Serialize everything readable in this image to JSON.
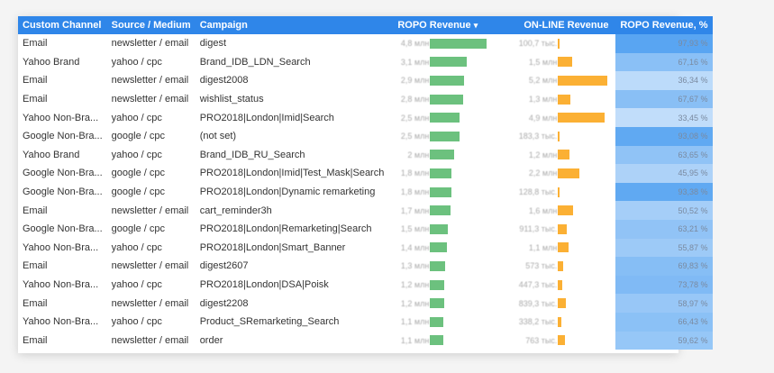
{
  "headers": {
    "channel": "Custom Channel",
    "source": "Source / Medium",
    "campaign": "Campaign",
    "ropo": "ROPO Revenue",
    "ropo_sort": "▾",
    "online": "ON-LINE Revenue",
    "pct": "ROPO Revenue, %"
  },
  "colors": {
    "header": "#2f86e9",
    "green": "#6cc17e",
    "orange": "#fbb034"
  },
  "rows": [
    {
      "channel": "Email",
      "source": "newsletter / email",
      "campaign": "digest",
      "ropo": "4,8 млн",
      "ropo_v": 4.8,
      "online": "100,7 тыс.",
      "online_v": 0.1,
      "pct": "97,93 %",
      "pct_v": 97.93
    },
    {
      "channel": "Yahoo Brand",
      "source": "yahoo / cpc",
      "campaign": "Brand_IDB_LDN_Search",
      "ropo": "3,1 млн",
      "ropo_v": 3.1,
      "online": "1,5 млн",
      "online_v": 1.5,
      "pct": "67,16 %",
      "pct_v": 67.16
    },
    {
      "channel": "Email",
      "source": "newsletter / email",
      "campaign": "digest2008",
      "ropo": "2,9 млн",
      "ropo_v": 2.9,
      "online": "5,2 млн",
      "online_v": 5.2,
      "pct": "36,34 %",
      "pct_v": 36.34
    },
    {
      "channel": "Email",
      "source": "newsletter / email",
      "campaign": "wishlist_status",
      "ropo": "2,8 млн",
      "ropo_v": 2.8,
      "online": "1,3 млн",
      "online_v": 1.3,
      "pct": "67,67 %",
      "pct_v": 67.67
    },
    {
      "channel": "Yahoo Non-Bra...",
      "source": "yahoo / cpc",
      "campaign": "PRO2018|London|Imid|Search",
      "ropo": "2,5 млн",
      "ropo_v": 2.5,
      "online": "4,9 млн",
      "online_v": 4.9,
      "pct": "33,45 %",
      "pct_v": 33.45
    },
    {
      "channel": "Google Non-Bra...",
      "source": "google / cpc",
      "campaign": "(not set)",
      "ropo": "2,5 млн",
      "ropo_v": 2.5,
      "online": "183,3 тыс.",
      "online_v": 0.18,
      "pct": "93,08 %",
      "pct_v": 93.08
    },
    {
      "channel": "Yahoo Brand",
      "source": "yahoo / cpc",
      "campaign": "Brand_IDB_RU_Search",
      "ropo": "2 млн",
      "ropo_v": 2.0,
      "online": "1,2 млн",
      "online_v": 1.2,
      "pct": "63,65 %",
      "pct_v": 63.65
    },
    {
      "channel": "Google Non-Bra...",
      "source": "google / cpc",
      "campaign": "PRO2018|London|Imid|Test_Mask|Search",
      "ropo": "1,8 млн",
      "ropo_v": 1.8,
      "online": "2,2 млн",
      "online_v": 2.2,
      "pct": "45,95 %",
      "pct_v": 45.95
    },
    {
      "channel": "Google Non-Bra...",
      "source": "google / cpc",
      "campaign": "PRO2018|London|Dynamic remarketing",
      "ropo": "1,8 млн",
      "ropo_v": 1.8,
      "online": "128,8 тыс.",
      "online_v": 0.13,
      "pct": "93,38 %",
      "pct_v": 93.38
    },
    {
      "channel": "Email",
      "source": "newsletter / email",
      "campaign": "cart_reminder3h",
      "ropo": "1,7 млн",
      "ropo_v": 1.7,
      "online": "1,6 млн",
      "online_v": 1.6,
      "pct": "50,52 %",
      "pct_v": 50.52
    },
    {
      "channel": "Google Non-Bra...",
      "source": "google / cpc",
      "campaign": "PRO2018|London|Remarketing|Search",
      "ropo": "1,5 млн",
      "ropo_v": 1.5,
      "online": "911,3 тыс.",
      "online_v": 0.91,
      "pct": "63,21 %",
      "pct_v": 63.21
    },
    {
      "channel": "Yahoo Non-Bra...",
      "source": "yahoo / cpc",
      "campaign": "PRO2018|London|Smart_Banner",
      "ropo": "1,4 млн",
      "ropo_v": 1.4,
      "online": "1,1 млн",
      "online_v": 1.1,
      "pct": "55,87 %",
      "pct_v": 55.87
    },
    {
      "channel": "Email",
      "source": "newsletter / email",
      "campaign": "digest2607",
      "ropo": "1,3 млн",
      "ropo_v": 1.3,
      "online": "573 тыс.",
      "online_v": 0.57,
      "pct": "69,83 %",
      "pct_v": 69.83
    },
    {
      "channel": "Yahoo Non-Bra...",
      "source": "yahoo / cpc",
      "campaign": "PRO2018|London|DSA|Poisk",
      "ropo": "1,2 млн",
      "ropo_v": 1.2,
      "online": "447,3 тыс.",
      "online_v": 0.45,
      "pct": "73,78 %",
      "pct_v": 73.78
    },
    {
      "channel": "Email",
      "source": "newsletter / email",
      "campaign": "digest2208",
      "ropo": "1,2 млн",
      "ropo_v": 1.2,
      "online": "839,3 тыс.",
      "online_v": 0.84,
      "pct": "58,97 %",
      "pct_v": 58.97
    },
    {
      "channel": "Yahoo Non-Bra...",
      "source": "yahoo / cpc",
      "campaign": "Product_SRemarketing_Search",
      "ropo": "1,1 млн",
      "ropo_v": 1.1,
      "online": "338,2 тыс.",
      "online_v": 0.34,
      "pct": "66,43 %",
      "pct_v": 66.43
    },
    {
      "channel": "Email",
      "source": "newsletter / email",
      "campaign": "order",
      "ropo": "1,1 млн",
      "ropo_v": 1.1,
      "online": "763 тыс.",
      "online_v": 0.76,
      "pct": "59,62 %",
      "pct_v": 59.62
    }
  ]
}
